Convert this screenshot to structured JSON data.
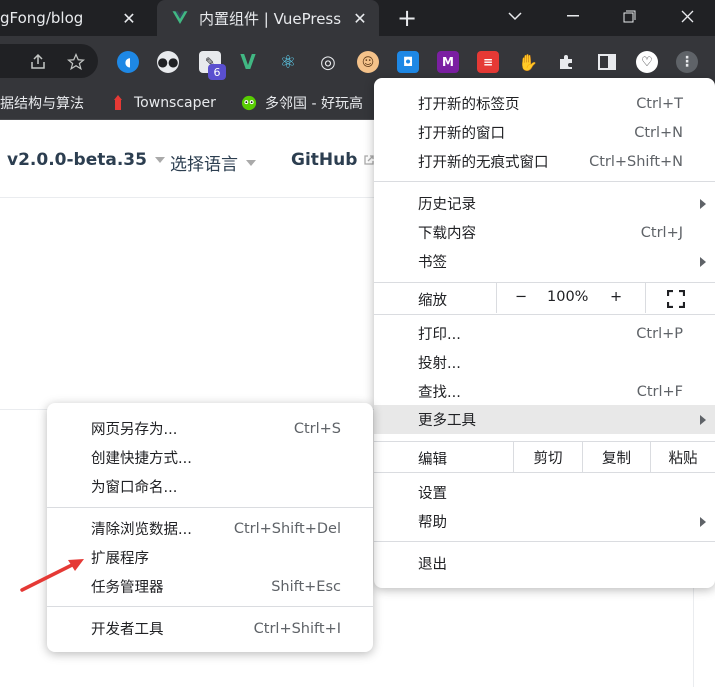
{
  "tabs": [
    {
      "title": "gFong/blog",
      "active": false
    },
    {
      "title": "内置组件 | VuePress",
      "active": true
    }
  ],
  "extensions_badge": "6",
  "bookmarks": [
    {
      "label": "据结构与算法"
    },
    {
      "label": "Townscaper"
    },
    {
      "label": "多邻国 - 好玩高"
    }
  ],
  "navbar": {
    "version": "v2.0.0-beta.35",
    "language": "选择语言",
    "github": "GitHub"
  },
  "menu": {
    "new_tab": {
      "label": "打开新的标签页",
      "shortcut": "Ctrl+T"
    },
    "new_window": {
      "label": "打开新的窗口",
      "shortcut": "Ctrl+N"
    },
    "incognito": {
      "label": "打开新的无痕式窗口",
      "shortcut": "Ctrl+Shift+N"
    },
    "history": {
      "label": "历史记录"
    },
    "downloads": {
      "label": "下载内容",
      "shortcut": "Ctrl+J"
    },
    "bookmarks": {
      "label": "书签"
    },
    "zoom": {
      "label": "缩放",
      "minus": "−",
      "value": "100%",
      "plus": "+"
    },
    "print": {
      "label": "打印...",
      "shortcut": "Ctrl+P"
    },
    "cast": {
      "label": "投射..."
    },
    "find": {
      "label": "查找...",
      "shortcut": "Ctrl+F"
    },
    "more_tools": {
      "label": "更多工具"
    },
    "edit": {
      "label": "编辑",
      "cut": "剪切",
      "copy": "复制",
      "paste": "粘贴"
    },
    "settings": {
      "label": "设置"
    },
    "help": {
      "label": "帮助"
    },
    "exit": {
      "label": "退出"
    }
  },
  "submenu": {
    "save_page": {
      "label": "网页另存为...",
      "shortcut": "Ctrl+S"
    },
    "create_shortcut": {
      "label": "创建快捷方式..."
    },
    "name_window": {
      "label": "为窗口命名..."
    },
    "clear_data": {
      "label": "清除浏览数据...",
      "shortcut": "Ctrl+Shift+Del"
    },
    "extensions": {
      "label": "扩展程序"
    },
    "task_manager": {
      "label": "任务管理器",
      "shortcut": "Shift+Esc"
    },
    "dev_tools": {
      "label": "开发者工具",
      "shortcut": "Ctrl+Shift+I"
    }
  },
  "colors": {
    "annotation_arrow": "#e53935",
    "vue_green": "#41b883"
  }
}
